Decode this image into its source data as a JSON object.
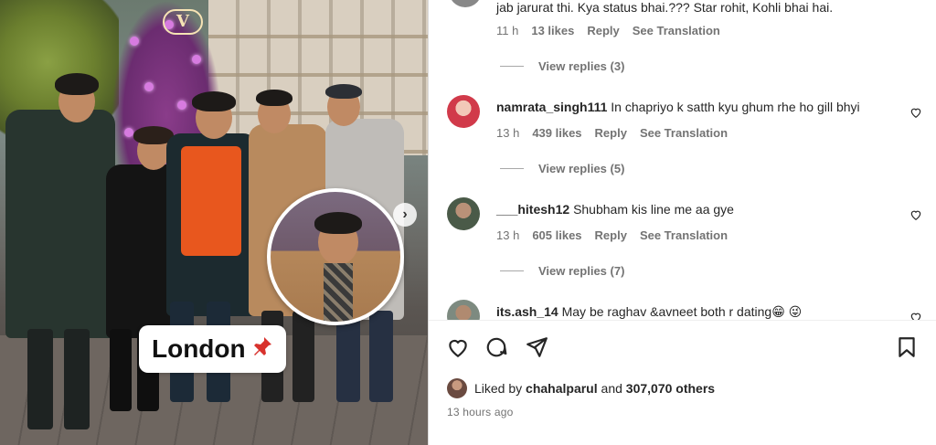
{
  "photo": {
    "location_sticker": "London",
    "sign_letter": "V"
  },
  "comments": {
    "top_partial": {
      "text": "jab jarurat thi. Kya status bhai.??? Star rohit, Kohli bhai hai.",
      "time": "11 h",
      "likes": "13 likes",
      "reply": "Reply",
      "translate": "See Translation",
      "view_replies": "View replies (3)"
    },
    "items": [
      {
        "username": "namrata_singh111",
        "text": "In chapriyo k satth kyu ghum rhe ho gill bhyi",
        "time": "13 h",
        "likes": "439 likes",
        "reply": "Reply",
        "translate": "See Translation",
        "view_replies": "View replies (5)"
      },
      {
        "username": "___hitesh12",
        "text": "Shubham kis line me aa gye",
        "time": "13 h",
        "likes": "605 likes",
        "reply": "Reply",
        "translate": "See Translation",
        "view_replies": "View replies (7)"
      },
      {
        "username": "its.ash_14",
        "text": "May be raghav &avneet both r dating😁 😜"
      }
    ]
  },
  "post": {
    "liked_prefix": "Liked by",
    "liked_user": "chahalparul",
    "liked_and": "and",
    "liked_count": "307,070 others",
    "timestamp": "13 hours ago"
  },
  "icons": {
    "like": "heart-icon",
    "comment": "comment-icon",
    "share": "send-icon",
    "save": "bookmark-icon",
    "next": "chevron-right-icon"
  }
}
